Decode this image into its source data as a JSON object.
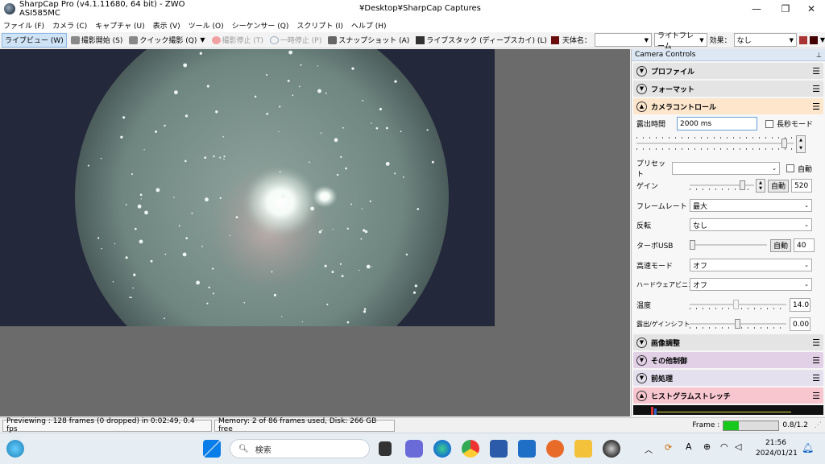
{
  "window": {
    "title": "SharpCap Pro (v4.1.11680, 64 bit) - ZWO ASI585MC",
    "path": "¥Desktop¥SharpCap Captures",
    "minimize": "—",
    "restore": "❐",
    "close": "✕"
  },
  "menu": [
    "ファイル (F)",
    "カメラ (C)",
    "キャプチャ (U)",
    "表示 (V)",
    "ツール (O)",
    "シーケンサー (Q)",
    "スクリプト (I)",
    "ヘルプ (H)"
  ],
  "toolbar": {
    "live_view": "ライブビュー (W)",
    "start_capture": "撮影開始 (S)",
    "quick_capture": "クイック撮影 (Q)",
    "stop_capture": "撮影停止 (T)",
    "pause": "一時停止 (P)",
    "snapshot": "スナップショット (A)",
    "live_stack": "ライブスタック (ディープスカイ) (L)",
    "target_label": "天体名：",
    "target_value": "",
    "frame_type": "ライトフレーム",
    "effect_label": "効果：",
    "effect_value": "なし"
  },
  "panel": {
    "title": "Camera Controls",
    "pin": "📌",
    "sections": {
      "profile": "プロファイル",
      "format": "フォーマット",
      "camera_control": "カメラコントロール",
      "image_adjust": "画像調整",
      "other_control": "その他制御",
      "preprocess": "前処理",
      "histogram": "ヒストグラムストレッチ"
    },
    "exposure": {
      "label": "露出時間",
      "value": "2000 ms",
      "long_mode": "長秒モード"
    },
    "preset": {
      "label": "プリセット",
      "value": "",
      "auto": "自動"
    },
    "gain": {
      "label": "ゲイン",
      "auto": "自動",
      "value": "520"
    },
    "frame_rate": {
      "label": "フレームレート",
      "value": "最大"
    },
    "flip": {
      "label": "反転",
      "value": "なし"
    },
    "turbo_usb": {
      "label": "ターボUSB",
      "auto": "自動",
      "value": "40"
    },
    "high_speed": {
      "label": "高速モード",
      "value": "オフ"
    },
    "hw_binning": {
      "label": "ハードウェアビニング",
      "value": "オフ"
    },
    "temperature": {
      "label": "温度",
      "value": "14.0"
    },
    "offset": {
      "label": "露出/ゲインシフト",
      "value": "0.00"
    }
  },
  "status": {
    "preview": "Previewing : 128 frames (0 dropped) in 0:02:49, 0.4 fps",
    "memory": "Memory: 2 of 86 frames used, Disk: 266 GB free",
    "frame_label": "Frame :",
    "frame_ratio": "0.8/1.2",
    "frame_fill": 0.27
  },
  "taskbar": {
    "search": "検索",
    "time": "21:56",
    "date": "2024/01/21",
    "ime": "A"
  },
  "colors": {
    "accent": "#cfe3f7",
    "capture_bg": "#23283a",
    "frame_green": "#19c81c"
  }
}
